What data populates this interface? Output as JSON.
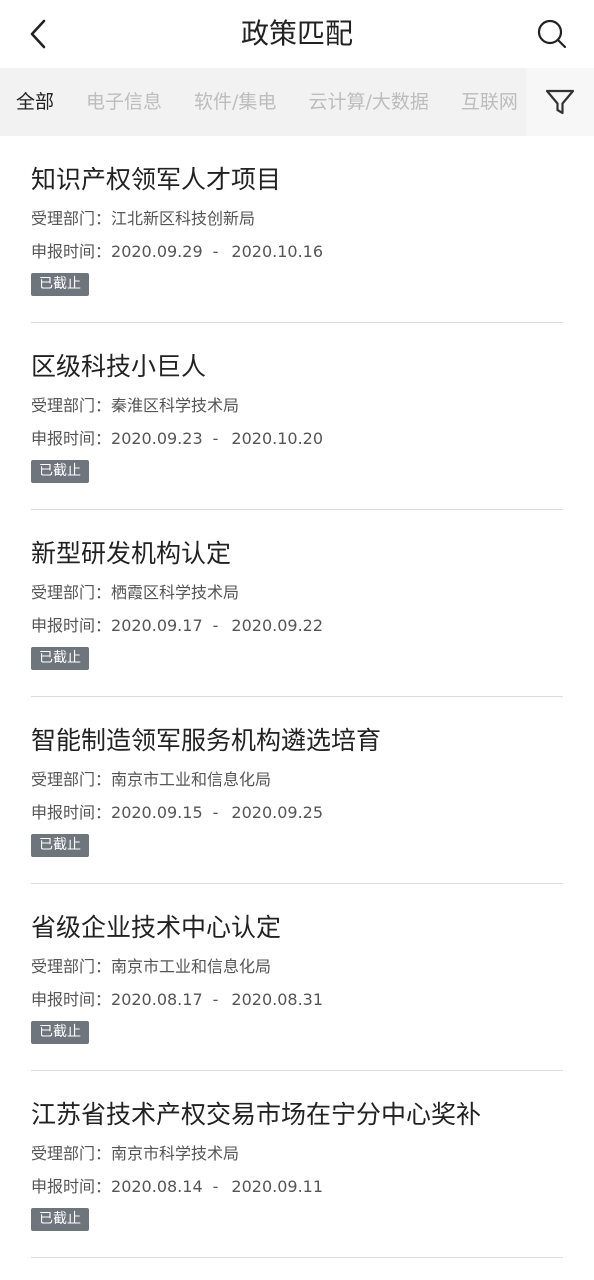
{
  "header": {
    "title": "政策匹配"
  },
  "tabs": [
    {
      "label": "全部",
      "active": true
    },
    {
      "label": "电子信息",
      "active": false
    },
    {
      "label": "软件/集电",
      "active": false
    },
    {
      "label": "云计算/大数据",
      "active": false
    },
    {
      "label": "互联网",
      "active": false
    }
  ],
  "items": [
    {
      "title": "知识产权领军人才项目",
      "dept_label": "受理部门：",
      "dept": "江北新区科技创新局",
      "date_label": "申报时间：",
      "start": "2020.09.29",
      "sep": "-",
      "end": "2020.10.16",
      "status": "已截止"
    },
    {
      "title": "区级科技小巨人",
      "dept_label": "受理部门：",
      "dept": "秦淮区科学技术局",
      "date_label": "申报时间：",
      "start": "2020.09.23",
      "sep": "-",
      "end": "2020.10.20",
      "status": "已截止"
    },
    {
      "title": "新型研发机构认定",
      "dept_label": "受理部门：",
      "dept": "栖霞区科学技术局",
      "date_label": "申报时间：",
      "start": "2020.09.17",
      "sep": "-",
      "end": "2020.09.22",
      "status": "已截止"
    },
    {
      "title": "智能制造领军服务机构遴选培育",
      "dept_label": "受理部门：",
      "dept": "南京市工业和信息化局",
      "date_label": "申报时间：",
      "start": "2020.09.15",
      "sep": "-",
      "end": "2020.09.25",
      "status": "已截止"
    },
    {
      "title": "省级企业技术中心认定",
      "dept_label": "受理部门：",
      "dept": "南京市工业和信息化局",
      "date_label": "申报时间：",
      "start": "2020.08.17",
      "sep": "-",
      "end": "2020.08.31",
      "status": "已截止"
    },
    {
      "title": "江苏省技术产权交易市场在宁分中心奖补",
      "dept_label": "受理部门：",
      "dept": "南京市科学技术局",
      "date_label": "申报时间：",
      "start": "2020.08.14",
      "sep": "-",
      "end": "2020.09.11",
      "status": "已截止"
    }
  ],
  "colors": {
    "badge_bg": "#6f757c",
    "tab_active": "#222222",
    "tab_inactive": "#bdbdbd",
    "divider": "#dcdcdc"
  },
  "icons": {
    "back": "chevron-left-icon",
    "search": "search-icon",
    "filter": "filter-icon"
  }
}
